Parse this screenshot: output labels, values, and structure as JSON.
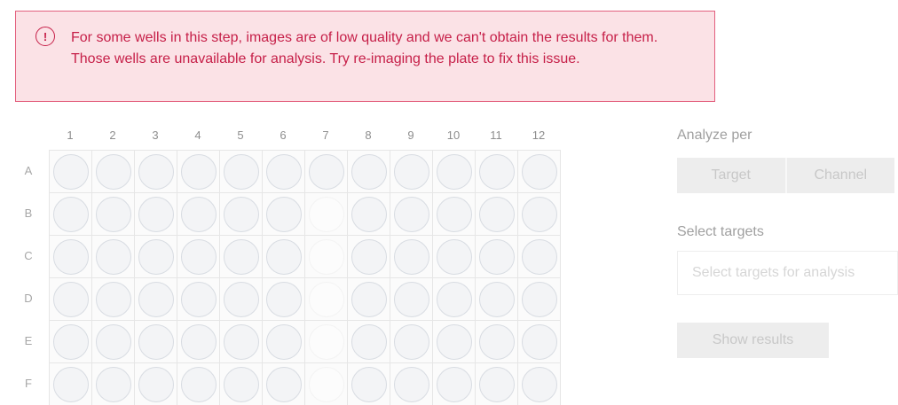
{
  "alert": {
    "icon": "exclamation-circle-icon",
    "message": "For some wells in this step, images are of low quality and we can't obtain the results for them. Those wells are unavailable for analysis. Try re-imaging the plate to fix this issue."
  },
  "plate": {
    "columns": [
      "1",
      "2",
      "3",
      "4",
      "5",
      "6",
      "7",
      "8",
      "9",
      "10",
      "11",
      "12"
    ],
    "rows": [
      "A",
      "B",
      "C",
      "D",
      "E",
      "F"
    ],
    "unavailable_wells": [
      "B7",
      "C7",
      "D7",
      "E7",
      "F7"
    ]
  },
  "analyze": {
    "label": "Analyze per",
    "options": [
      "Target",
      "Channel"
    ]
  },
  "targets": {
    "label": "Select targets",
    "placeholder": "Select targets for analysis"
  },
  "actions": {
    "show_results": "Show results"
  },
  "colors": {
    "alert_text": "#c61f48",
    "alert_bg": "#fbe2e6",
    "alert_border": "#e3607e"
  }
}
